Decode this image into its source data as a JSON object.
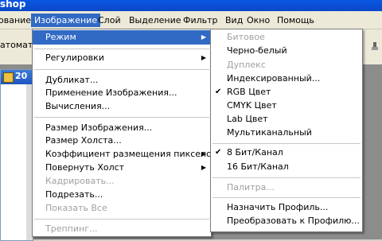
{
  "window": {
    "title_fragment": "shop"
  },
  "menubar": {
    "items": [
      "ование",
      "Изображение",
      "Слой",
      "Выделение",
      "Фильтр",
      "Вид",
      "Окно",
      "Помощь"
    ],
    "active": "Изображение"
  },
  "toolbar": {
    "left_text": "атомати"
  },
  "document": {
    "title_fragment": "20"
  },
  "image_menu": {
    "items": [
      {
        "label": "Режим",
        "submenu": true,
        "state": "highlighted"
      },
      {
        "label": "Регулировки",
        "submenu": true
      },
      {
        "label": "Дубликат..."
      },
      {
        "label": "Применение Изображения..."
      },
      {
        "label": "Вычисления..."
      },
      {
        "label": "Размер Изображения..."
      },
      {
        "label": "Размер Холста..."
      },
      {
        "label": "Коэффициент размещения пикселов",
        "submenu": true
      },
      {
        "label": "Повернуть Холст",
        "submenu": true
      },
      {
        "label": "Кадрировать...",
        "state": "disabled"
      },
      {
        "label": "Подрезать..."
      },
      {
        "label": "Показать Все",
        "state": "disabled"
      },
      {
        "label": "Треппинг...",
        "state": "disabled"
      }
    ]
  },
  "mode_submenu": {
    "items": [
      {
        "label": "Битовое",
        "state": "disabled"
      },
      {
        "label": "Черно-белый"
      },
      {
        "label": "Дуплекс",
        "state": "disabled"
      },
      {
        "label": "Индексированный..."
      },
      {
        "label": "RGB Цвет",
        "checked": true
      },
      {
        "label": "CMYK Цвет"
      },
      {
        "label": "Lab Цвет"
      },
      {
        "label": "Мультиканальный"
      },
      {
        "label": "8 Бит/Канал",
        "checked": true
      },
      {
        "label": "16 Бит/Канал"
      },
      {
        "label": "Палитра...",
        "state": "disabled"
      },
      {
        "label": "Назначить Профиль..."
      },
      {
        "label": "Преобразовать к Профилю..."
      }
    ]
  },
  "glyphs": {
    "arrow": "▶",
    "check": "✔"
  },
  "colors": {
    "highlight": "#316ac5",
    "menubar_bg": "#ece9d8",
    "disabled_text": "#a0a0a0",
    "titlebar": "#0b47c6"
  }
}
